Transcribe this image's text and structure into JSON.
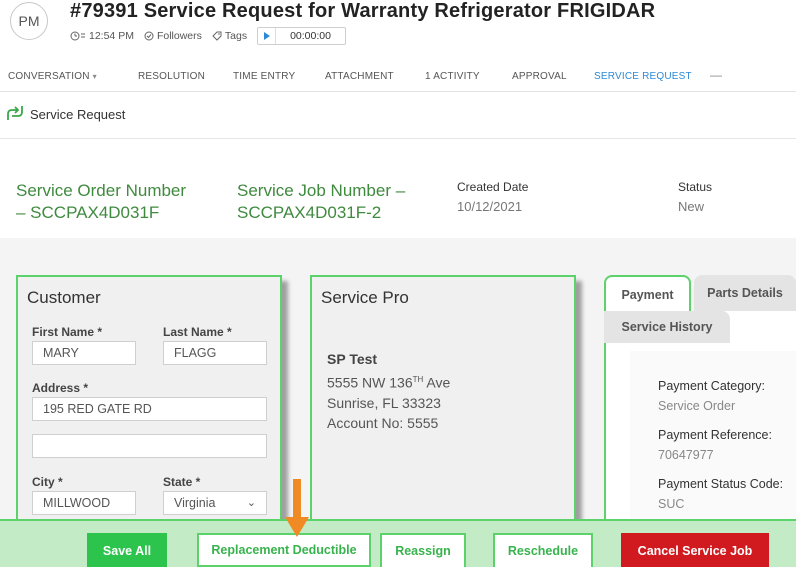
{
  "header": {
    "avatar_initials": "PM",
    "title": "#79391  Service Request for Warranty Refrigerator FRIGIDAR",
    "time": "12:54 PM",
    "followers_label": "Followers",
    "tags_label": "Tags",
    "timer": "00:00:00"
  },
  "tabs": [
    {
      "label": "CONVERSATION"
    },
    {
      "label": "RESOLUTION"
    },
    {
      "label": "TIME ENTRY"
    },
    {
      "label": "ATTACHMENT"
    },
    {
      "label": "1 ACTIVITY"
    },
    {
      "label": "APPROVAL"
    },
    {
      "label": "SERVICE REQUEST"
    }
  ],
  "section_title": "Service Request",
  "info": {
    "service_order_line1": "Service Order Number",
    "service_order_line2": "– SCCPAX4D031F",
    "service_job_line1": "Service Job Number –",
    "service_job_line2": "SCCPAX4D031F-2",
    "created_label": "Created Date",
    "created_value": "10/12/2021",
    "status_label": "Status",
    "status_value": "New"
  },
  "customer": {
    "title": "Customer",
    "first_name_label": "First Name *",
    "first_name": "MARY",
    "last_name_label": "Last Name *",
    "last_name": "FLAGG",
    "address_label": "Address *",
    "address1": "195 RED GATE RD",
    "address2": "",
    "city_label": "City *",
    "city": "MILLWOOD",
    "state_label": "State *",
    "state": "Virginia"
  },
  "service_pro": {
    "title": "Service Pro",
    "name": "SP Test",
    "address_prefix": "5555 NW 136",
    "address_sup": "TH",
    "address_suffix": " Ave",
    "city_line": "Sunrise, FL 33323",
    "account": "Account No: 5555"
  },
  "right_panel": {
    "tab_payment": "Payment",
    "tab_parts": "Parts Details",
    "tab_history": "Service History",
    "payment_category_label": "Payment Category:",
    "payment_category": "Service Order",
    "payment_reference_label": "Payment Reference:",
    "payment_reference": "70647977",
    "payment_status_label": "Payment Status Code:",
    "payment_status": "SUC"
  },
  "actions": {
    "save_all": "Save All",
    "replacement_deductible": "Replacement Deductible",
    "reassign": "Reassign",
    "reschedule": "Reschedule",
    "cancel_job": "Cancel Service Job"
  },
  "colors": {
    "accent_green": "#5cd36a",
    "link_blue": "#2c8ad8",
    "title_green": "#3f8a3f",
    "danger_red": "#d01a1f",
    "arrow_orange": "#f08a24"
  }
}
